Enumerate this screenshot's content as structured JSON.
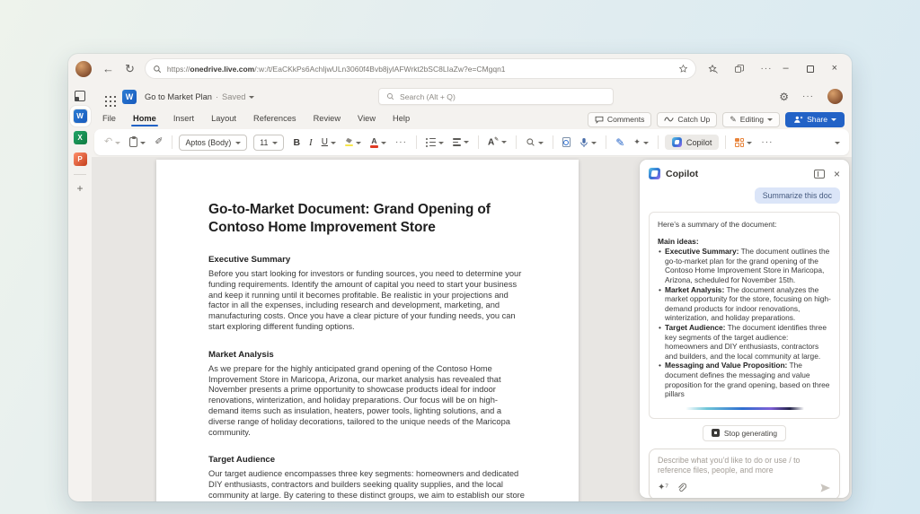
{
  "browser": {
    "url_scheme": "https://",
    "url_host": "onedrive.live.com",
    "url_path": "/:w:/t/EaCKkPs6AchIjwULn3060f4Bvb8jylAFWrkt2bSC8LIaZw?e=CMgqn1"
  },
  "app_header": {
    "doc_title": "Go to Market Plan",
    "separator": "·",
    "saved_status": "Saved",
    "search_placeholder": "Search (Alt + Q)"
  },
  "menu": {
    "tabs": [
      "File",
      "Home",
      "Insert",
      "Layout",
      "References",
      "Review",
      "View",
      "Help"
    ],
    "comments": "Comments",
    "catch_up": "Catch Up",
    "editing": "Editing",
    "share": "Share"
  },
  "ribbon": {
    "font_name": "Aptos (Body)",
    "font_size": "11",
    "bold": "B",
    "italic": "I",
    "underline": "U",
    "font_color_letter": "A",
    "styles_letter": "A",
    "copilot": "Copilot"
  },
  "document": {
    "title": "Go-to-Market Document: Grand Opening of Contoso Home Improvement Store",
    "sections": [
      {
        "heading": "Executive Summary",
        "body": "Before you start looking for investors or funding sources, you need to determine your funding requirements. Identify the amount of capital you need to start your business and keep it running until it becomes profitable. Be realistic in your projections and factor in all the expenses, including research and development, marketing, and manufacturing costs. Once you have a clear picture of your funding needs, you can start exploring different funding options."
      },
      {
        "heading": "Market Analysis",
        "body": "As we prepare for the highly anticipated grand opening of the Contoso Home Improvement Store in Maricopa, Arizona, our market analysis has revealed that November presents a prime opportunity to showcase products ideal for indoor renovations, winterization, and holiday preparations. Our focus will be on high-demand items such as insulation, heaters, power tools, lighting solutions, and a diverse range of holiday decorations, tailored to the unique needs of the Maricopa community."
      },
      {
        "heading": "Target Audience",
        "body": "Our target audience encompasses three key segments: homeowners and dedicated DIY enthusiasts, contractors and builders seeking quality supplies, and the local community at large. By catering to these distinct groups, we aim to establish our store as the ultimate"
      }
    ]
  },
  "copilot": {
    "panel_title": "Copilot",
    "user_message": "Summarize this doc",
    "intro": "Here’s a summary of the document:",
    "main_ideas": "Main ideas:",
    "bullets": [
      {
        "lead": "Executive Summary:",
        "text": " The document outlines the go-to-market plan for the grand opening of the Contoso Home Improvement Store in Maricopa, Arizona, scheduled for November 15th."
      },
      {
        "lead": "Market Analysis:",
        "text": " The document analyzes the market opportunity for the store, focusing on high-demand products for indoor renovations, winterization, and holiday preparations."
      },
      {
        "lead": "Target Audience:",
        "text": " The document identifies three key segments of the target audience: homeowners and DIY enthusiasts, contractors and builders, and the local community at large."
      },
      {
        "lead": "Messaging and Value Proposition:",
        "text": " The document defines the messaging and value proposition for the grand opening, based on three pillars"
      }
    ],
    "stop_label": "Stop generating",
    "input_placeholder": "Describe what you’d like to do or use / to reference files, people, and more"
  },
  "colors": {
    "accent_blue": "#2262c6",
    "word_blue": "#185abd",
    "excel_green": "#107c41",
    "powerpoint_orange": "#c43e1c",
    "designer_orange": "#e8833a",
    "highlight_yellow": "#f7e64c",
    "font_color_red": "#e03b24",
    "user_bubble_blue": "#dbe5f8"
  }
}
